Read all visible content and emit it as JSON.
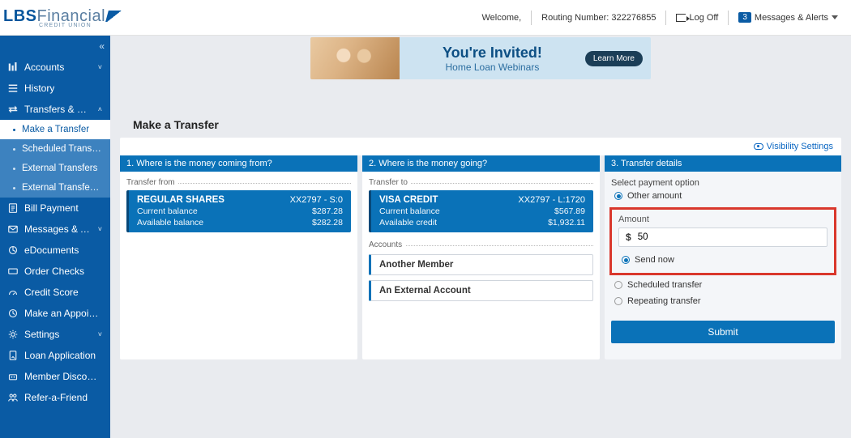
{
  "header": {
    "logo_main": "LBS",
    "logo_light": "Financial",
    "logo_sub": "CREDIT UNION",
    "welcome": "Welcome,",
    "routing_label": "Routing Number:",
    "routing_number": "322276855",
    "logoff": "Log Off",
    "msg_badge": "3",
    "msgs_link": "Messages & Alerts"
  },
  "banner": {
    "line1": "You're Invited!",
    "line2": "Home Loan Webinars",
    "cta": "Learn More"
  },
  "sidebar": {
    "items": [
      {
        "label": "Accounts",
        "exp": "⌄"
      },
      {
        "label": "History"
      },
      {
        "label": "Transfers & Payments",
        "exp": "^"
      },
      {
        "label": "Make a Transfer",
        "sub": true,
        "active": true
      },
      {
        "label": "Scheduled Transfers",
        "sub": true
      },
      {
        "label": "External Transfers",
        "sub": true
      },
      {
        "label": "External Transfer Activity",
        "sub": true
      },
      {
        "label": "Bill Payment"
      },
      {
        "label": "Messages & Alerts",
        "exp": "⌄"
      },
      {
        "label": "eDocuments"
      },
      {
        "label": "Order Checks"
      },
      {
        "label": "Credit Score"
      },
      {
        "label": "Make an Appointment"
      },
      {
        "label": "Settings",
        "exp": "⌄"
      },
      {
        "label": "Loan Application"
      },
      {
        "label": "Member Discounts"
      },
      {
        "label": "Refer-a-Friend"
      }
    ]
  },
  "page": {
    "title": "Make a Transfer",
    "visibility": "Visibility Settings",
    "col1": {
      "head": "1. Where is the money coming from?",
      "legend": "Transfer from",
      "acct_name": "REGULAR SHARES",
      "acct_tag": "XX2797 - S:0",
      "bal1_lbl": "Current balance",
      "bal1_val": "$287.28",
      "bal2_lbl": "Available balance",
      "bal2_val": "$282.28"
    },
    "col2": {
      "head": "2. Where is the money going?",
      "legend": "Transfer to",
      "acct_name": "VISA CREDIT",
      "acct_tag": "XX2797 - L:1720",
      "bal1_lbl": "Current balance",
      "bal1_val": "$567.89",
      "bal2_lbl": "Available credit",
      "bal2_val": "$1,932.11",
      "legend2": "Accounts",
      "opt1": "Another Member",
      "opt2": "An External Account"
    },
    "col3": {
      "head": "3. Transfer details",
      "select_lbl": "Select payment option",
      "other_amount": "Other amount",
      "amount_lbl": "Amount",
      "currency": "$",
      "amount_value": "50",
      "send_now": "Send now",
      "scheduled": "Scheduled transfer",
      "repeating": "Repeating transfer",
      "submit": "Submit"
    }
  }
}
